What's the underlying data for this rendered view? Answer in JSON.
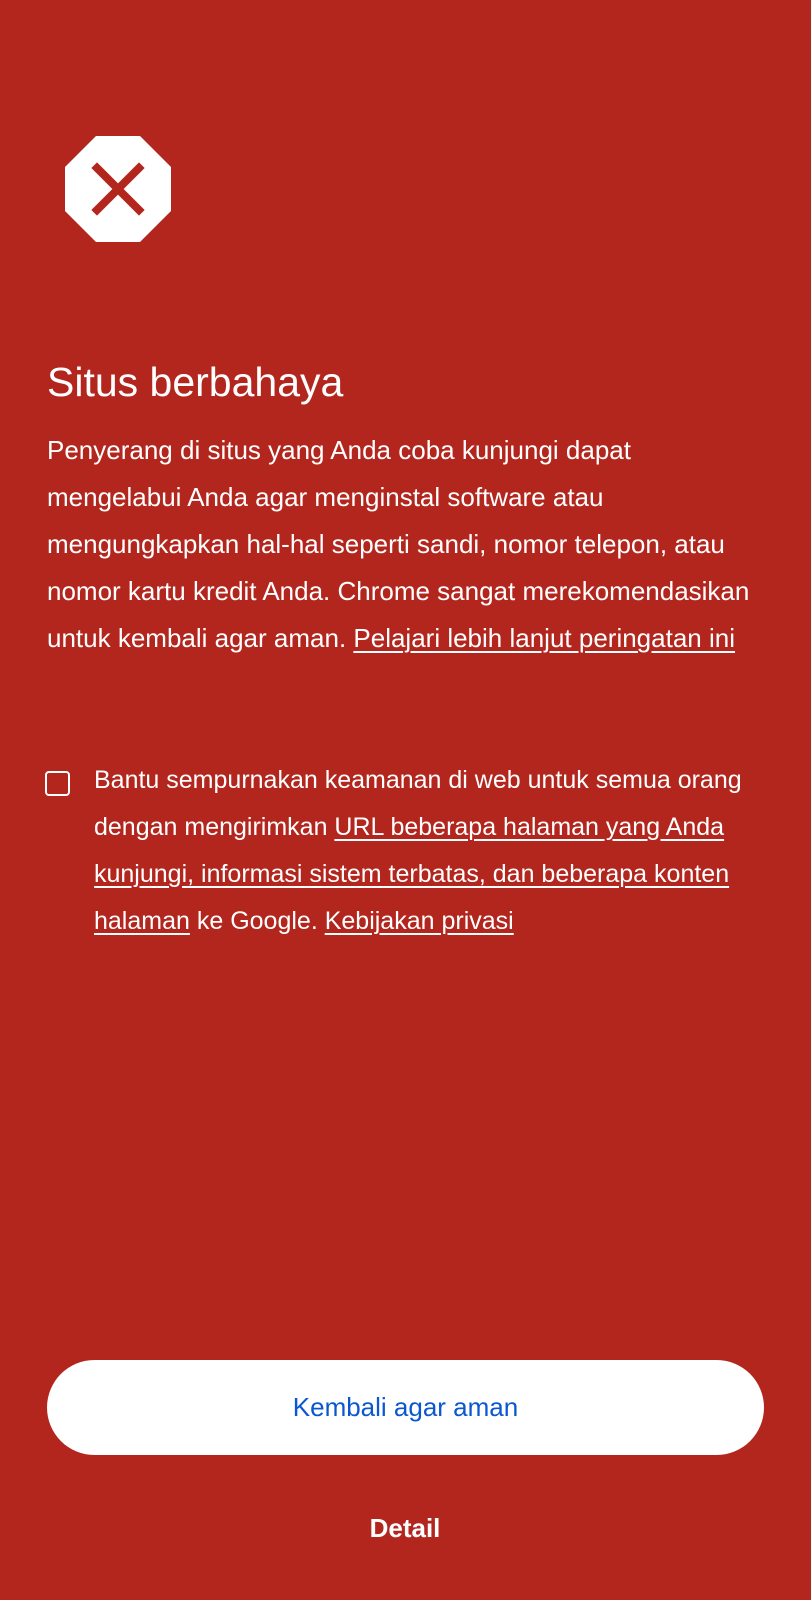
{
  "colors": {
    "background": "#b3261e",
    "text": "#ffffff",
    "primary_button_bg": "#ffffff",
    "primary_button_text": "#0b57d0",
    "icon_fill": "#ffffff",
    "icon_mark": "#b3261e"
  },
  "icon": "stop-octagon-x-icon",
  "title": "Situs berbahaya",
  "body": {
    "text": "Penyerang di situs yang Anda coba kunjungi dapat mengelabui Anda agar menginstal software atau mengungkapkan hal-hal seperti sandi, nomor telepon, atau nomor kartu kredit Anda. Chrome sangat merekomendasikan untuk kembali agar aman. ",
    "learn_more_link": "Pelajari lebih lanjut peringatan ini"
  },
  "optin": {
    "checked": false,
    "text_before": "Bantu sempurnakan keamanan di web untuk semua orang dengan mengirimkan ",
    "data_link": "URL beberapa halaman yang Anda kunjungi, informasi sistem terbatas, dan beberapa konten halaman",
    "text_after": " ke Google. ",
    "privacy_link": "Kebijakan privasi"
  },
  "buttons": {
    "primary_label": "Kembali agar aman",
    "detail_label": "Detail"
  }
}
